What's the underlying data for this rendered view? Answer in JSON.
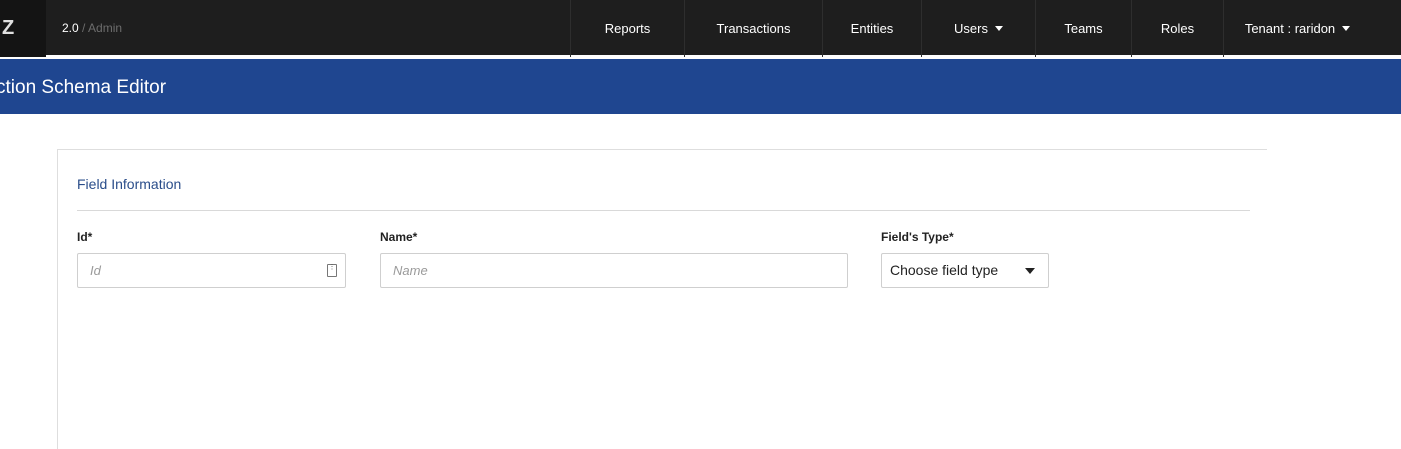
{
  "navbar": {
    "brand": "Z",
    "version": "2.0",
    "separator": "/",
    "section": "Admin",
    "items": [
      {
        "label": "Reports",
        "dropdown": false
      },
      {
        "label": "Transactions",
        "dropdown": false
      },
      {
        "label": "Entities",
        "dropdown": false
      },
      {
        "label": "Users",
        "dropdown": true
      },
      {
        "label": "Teams",
        "dropdown": false
      },
      {
        "label": "Roles",
        "dropdown": false
      },
      {
        "label": "Tenant : raridon",
        "dropdown": true
      }
    ]
  },
  "banner": {
    "title": "ction Schema Editor"
  },
  "form": {
    "section_title": "Field Information",
    "id_label": "Id*",
    "id_placeholder": "Id",
    "name_label": "Name*",
    "name_placeholder": "Name",
    "type_label": "Field's Type*",
    "type_value": "Choose field type"
  },
  "colors": {
    "navbar_bg": "#1e1e1e",
    "banner_bg": "#1f4690",
    "section_title": "#2a4d8a"
  }
}
